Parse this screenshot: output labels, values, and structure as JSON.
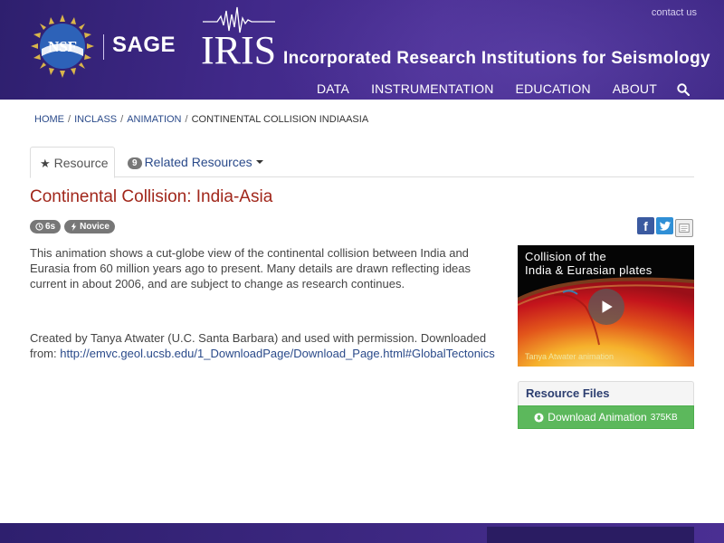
{
  "header": {
    "contact": "contact us",
    "sage": "SAGE",
    "nsf_logo_text": "NSF",
    "iris_logo_text": "IRIS",
    "org_name": "Incorporated Research Institutions for Seismology",
    "nav": [
      "DATA",
      "INSTRUMENTATION",
      "EDUCATION",
      "ABOUT"
    ],
    "search_icon": "search-icon"
  },
  "breadcrumb": {
    "items": [
      "HOME",
      "INCLASS",
      "ANIMATION"
    ],
    "current": "CONTINENTAL COLLISION INDIAASIA"
  },
  "tabs": {
    "resource": "Resource",
    "related_count": "9",
    "related": "Related Resources"
  },
  "title": "Continental Collision: India-Asia",
  "badges": {
    "duration": "6s",
    "level": "Novice"
  },
  "share": {
    "facebook": "f"
  },
  "description": "This animation shows a cut-globe view of the continental collision between India and Eurasia from 60 million years ago to present. Many details are drawn reflecting ideas current in about 2006, and are subject to change as research continues.",
  "credit": {
    "text": "Created by Tanya Atwater (U.C. Santa Barbara) and used with permission. Downloaded from: ",
    "link": "http://emvc.geol.ucsb.edu/1_DownloadPage/Download_Page.html#GlobalTectonics"
  },
  "video": {
    "caption_line1": "Collision of the",
    "caption_line2": "India & Eurasian plates",
    "credit": "Tanya Atwater animation"
  },
  "resource_files": {
    "heading": "Resource Files",
    "download_label": "Download Animation",
    "download_size": "375KB"
  },
  "colors": {
    "header_purple": "#41298a",
    "title_red": "#a1271b",
    "link_blue": "#2a4a8a",
    "download_green": "#5cb85c"
  }
}
